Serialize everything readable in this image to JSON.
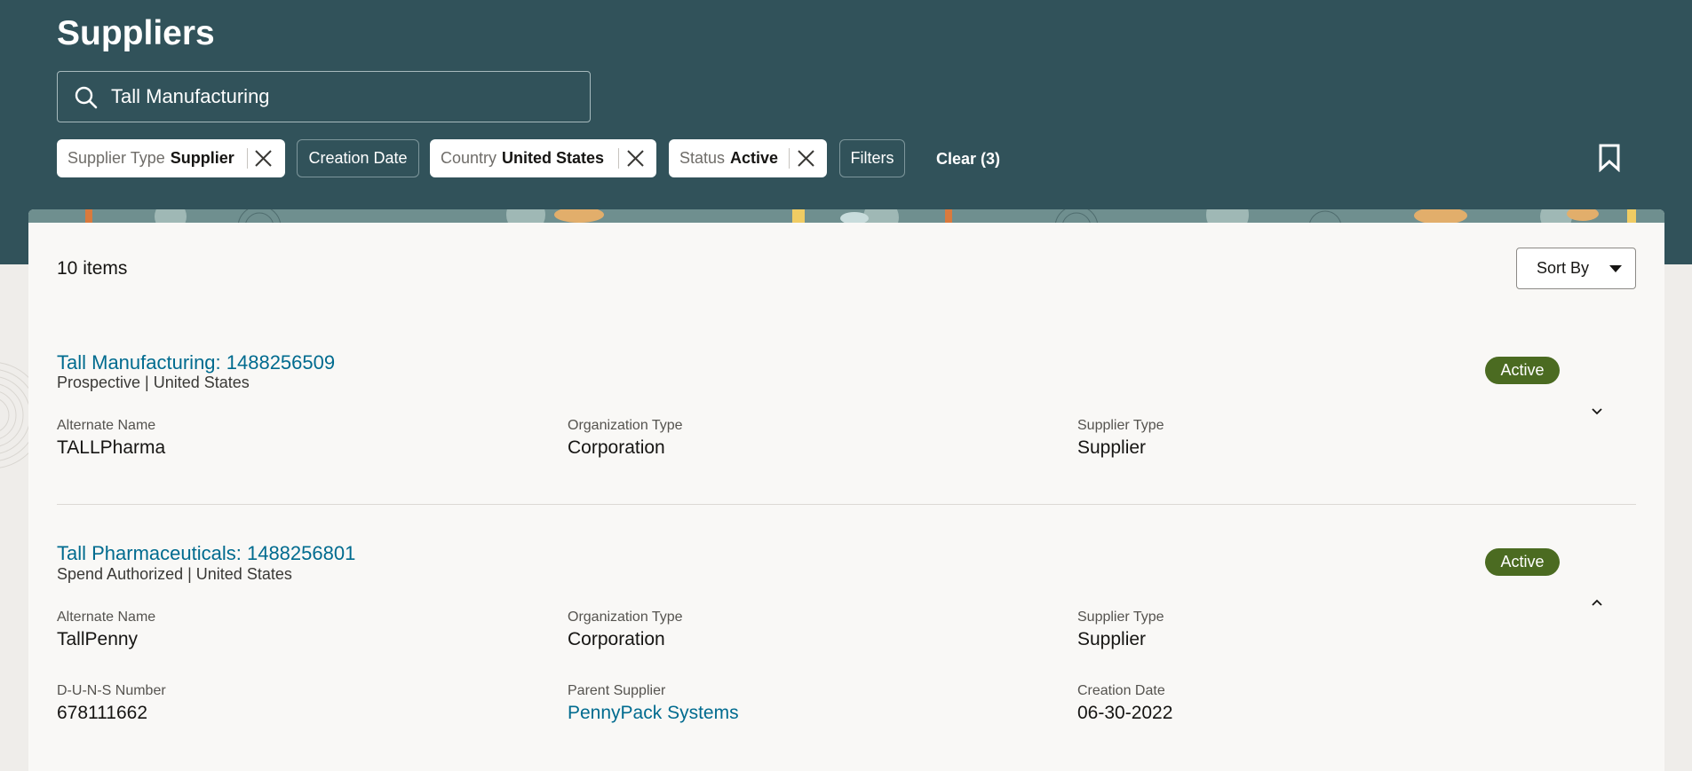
{
  "page": {
    "title": "Suppliers"
  },
  "search": {
    "value": "Tall Manufacturing"
  },
  "filters": {
    "supplier_type": {
      "label": "Supplier Type",
      "value": "Supplier"
    },
    "creation_date": {
      "label": "Creation Date"
    },
    "country": {
      "label": "Country",
      "value": "United States"
    },
    "status": {
      "label": "Status",
      "value": "Active"
    },
    "filters_label": "Filters",
    "clear_label": "Clear (3)"
  },
  "results": {
    "count_label": "10 items",
    "sort_label": "Sort By",
    "items": [
      {
        "title": "Tall Manufacturing: 1488256509",
        "subtitle": "Prospective | United States",
        "status": "Active",
        "fields": [
          {
            "label": "Alternate Name",
            "value": "TALLPharma"
          },
          {
            "label": "Organization Type",
            "value": "Corporation"
          },
          {
            "label": "Supplier Type",
            "value": "Supplier"
          }
        ]
      },
      {
        "title": "Tall Pharmaceuticals: 1488256801",
        "subtitle": "Spend Authorized | United States",
        "status": "Active",
        "fields": [
          {
            "label": "Alternate Name",
            "value": "TallPenny"
          },
          {
            "label": "Organization Type",
            "value": "Corporation"
          },
          {
            "label": "Supplier Type",
            "value": "Supplier"
          },
          {
            "label": "D-U-N-S Number",
            "value": "678111662"
          },
          {
            "label": "Parent Supplier",
            "value": "PennyPack Systems"
          },
          {
            "label": "Creation Date",
            "value": "06-30-2022"
          }
        ]
      }
    ]
  },
  "colors": {
    "header": "#31525a",
    "link": "#006b8f",
    "active_badge": "#4b6b21",
    "panel": "#f9f8f6"
  },
  "icons": [
    "search-icon",
    "close-icon",
    "bookmark-icon",
    "chevron-down-icon",
    "chevron-up-icon",
    "caret-down-icon"
  ]
}
